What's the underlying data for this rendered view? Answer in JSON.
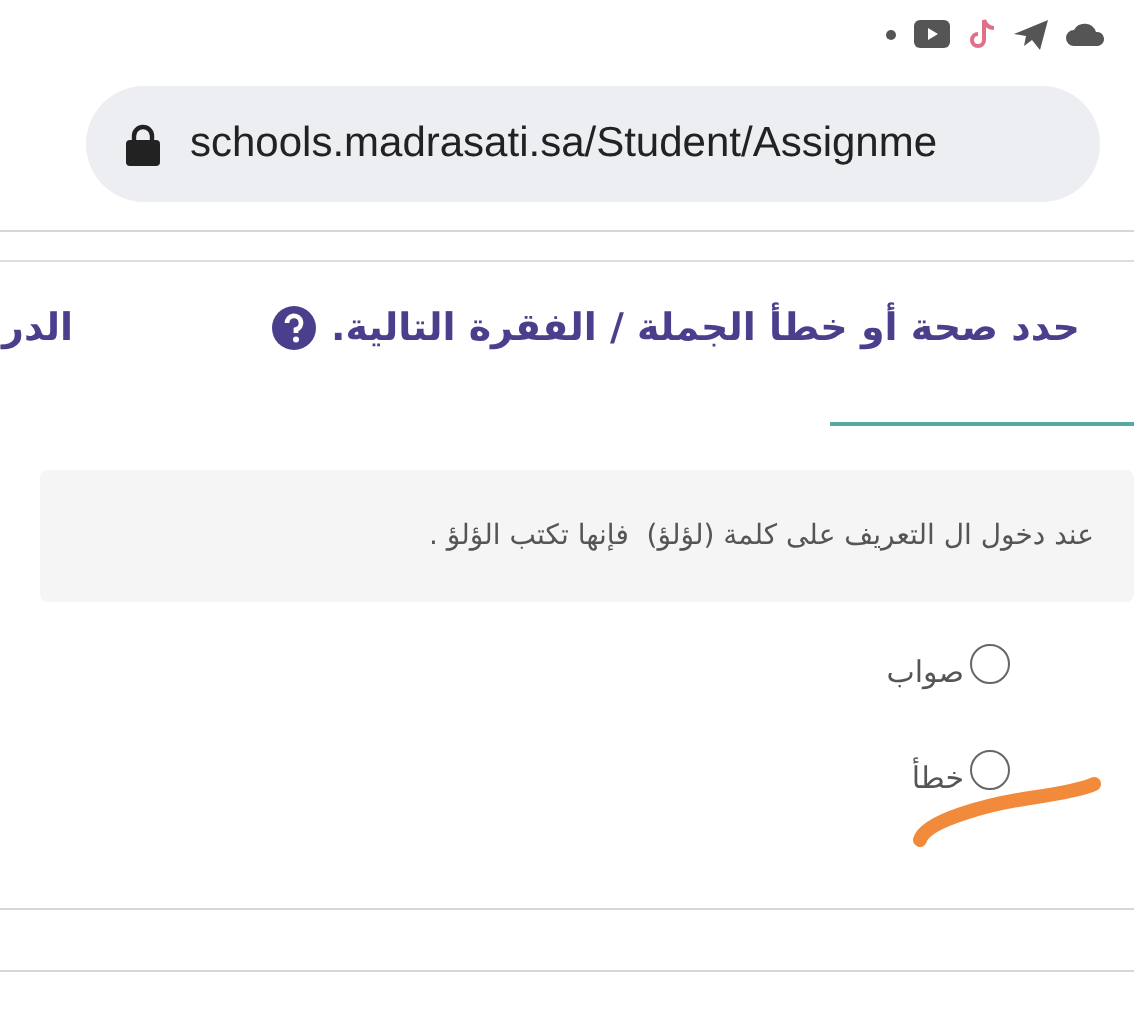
{
  "address_bar": {
    "url": "schools.madrasati.sa/Student/Assignme"
  },
  "question": {
    "title": "حدد صحة أو خطأ الجملة / الفقرة التالية.",
    "next_tab": "الدر",
    "statement": "عند دخول ال التعريف على كلمة (لؤلؤ)  فإنها تكتب الؤلؤ .",
    "options": [
      {
        "label": "صواب",
        "selected": false
      },
      {
        "label": "خطأ",
        "selected": false
      }
    ]
  }
}
